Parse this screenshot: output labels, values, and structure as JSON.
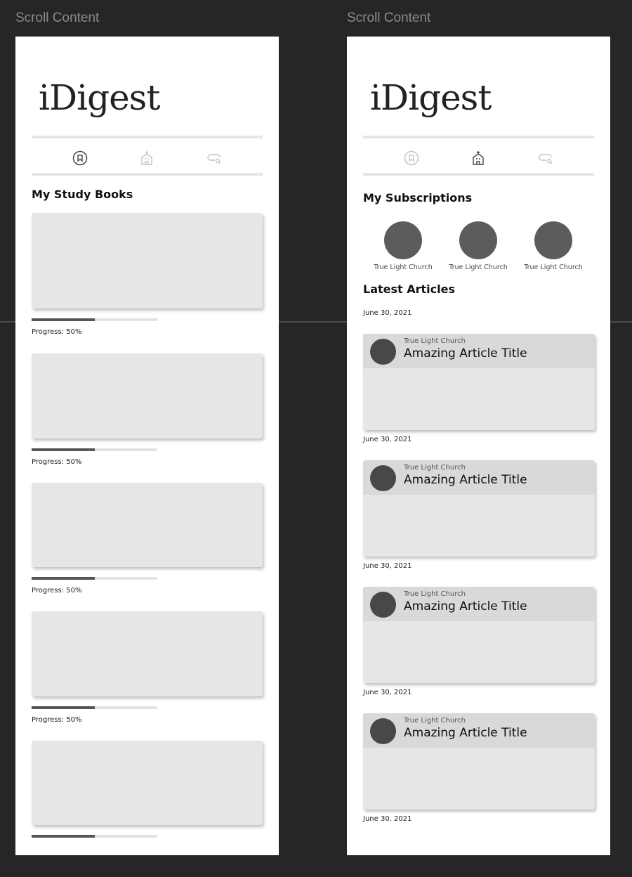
{
  "frames": [
    {
      "label": "Scroll Content",
      "logo": "iDigest",
      "heading": "My Study Books",
      "nav": [
        {
          "icon": "bookmark-circle-icon",
          "active": true
        },
        {
          "icon": "church-icon",
          "active": false
        },
        {
          "icon": "search-chat-icon",
          "active": false
        }
      ],
      "books": [
        {
          "progress": 50,
          "progress_label": "Progress: 50%"
        },
        {
          "progress": 50,
          "progress_label": "Progress: 50%"
        },
        {
          "progress": 50,
          "progress_label": "Progress: 50%"
        },
        {
          "progress": 50,
          "progress_label": "Progress: 50%"
        },
        {
          "progress": 50
        }
      ]
    },
    {
      "label": "Scroll Content",
      "logo": "iDigest",
      "heading": "My Subscriptions",
      "articles_heading": "Latest Articles",
      "nav": [
        {
          "icon": "bookmark-circle-icon",
          "active": false
        },
        {
          "icon": "church-icon",
          "active": true
        },
        {
          "icon": "search-chat-icon",
          "active": false
        }
      ],
      "subscriptions": [
        {
          "name": "True Light Church"
        },
        {
          "name": "True Light Church"
        },
        {
          "name": "True Light Church"
        }
      ],
      "first_date": "June 30, 2021",
      "articles": [
        {
          "church": "True Light Church",
          "title": "Amazing Article Title",
          "date": "June 30, 2021"
        },
        {
          "church": "True Light Church",
          "title": "Amazing Article Title",
          "date": "June 30, 2021"
        },
        {
          "church": "True Light Church",
          "title": "Amazing Article Title",
          "date": "June 30, 2021"
        },
        {
          "church": "True Light Church",
          "title": "Amazing Article Title",
          "date": "June 30, 2021"
        }
      ]
    }
  ],
  "colors": {
    "background": "#262626",
    "placeholder": "#e6e6e6",
    "progress_fill": "#555555",
    "avatar": "#5c5c5c"
  }
}
